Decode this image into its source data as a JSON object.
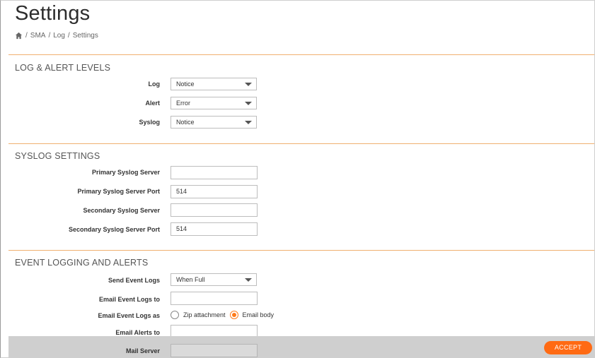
{
  "page": {
    "title": "Settings"
  },
  "breadcrumb": {
    "items": [
      "SMA",
      "Log",
      "Settings"
    ],
    "separator": "/",
    "home_icon": "home-icon"
  },
  "sections": {
    "log_alert": {
      "title": "LOG & ALERT LEVELS",
      "log_label": "Log",
      "log_value": "Notice",
      "alert_label": "Alert",
      "alert_value": "Error",
      "syslog_label": "Syslog",
      "syslog_value": "Notice"
    },
    "syslog": {
      "title": "SYSLOG SETTINGS",
      "primary_server_label": "Primary Syslog Server",
      "primary_server_value": "",
      "primary_port_label": "Primary Syslog Server Port",
      "primary_port_value": "514",
      "secondary_server_label": "Secondary Syslog Server",
      "secondary_server_value": "",
      "secondary_port_label": "Secondary Syslog Server Port",
      "secondary_port_value": "514"
    },
    "event": {
      "title": "EVENT LOGGING AND ALERTS",
      "send_logs_label": "Send Event Logs",
      "send_logs_value": "When Full",
      "email_logs_to_label": "Email Event Logs to",
      "email_logs_to_value": "",
      "email_logs_as_label": "Email Event Logs as",
      "option_zip": "Zip attachment",
      "option_body": "Email body",
      "selected": "Email body",
      "email_alerts_label": "Email Alerts to",
      "email_alerts_value": "",
      "mail_server_label": "Mail Server",
      "mail_server_value": ""
    }
  },
  "footer": {
    "accept_label": "ACCEPT"
  },
  "colors": {
    "accent": "#ff6a13",
    "rule": "#f0b070",
    "footer_bg": "#cfcfcf"
  }
}
